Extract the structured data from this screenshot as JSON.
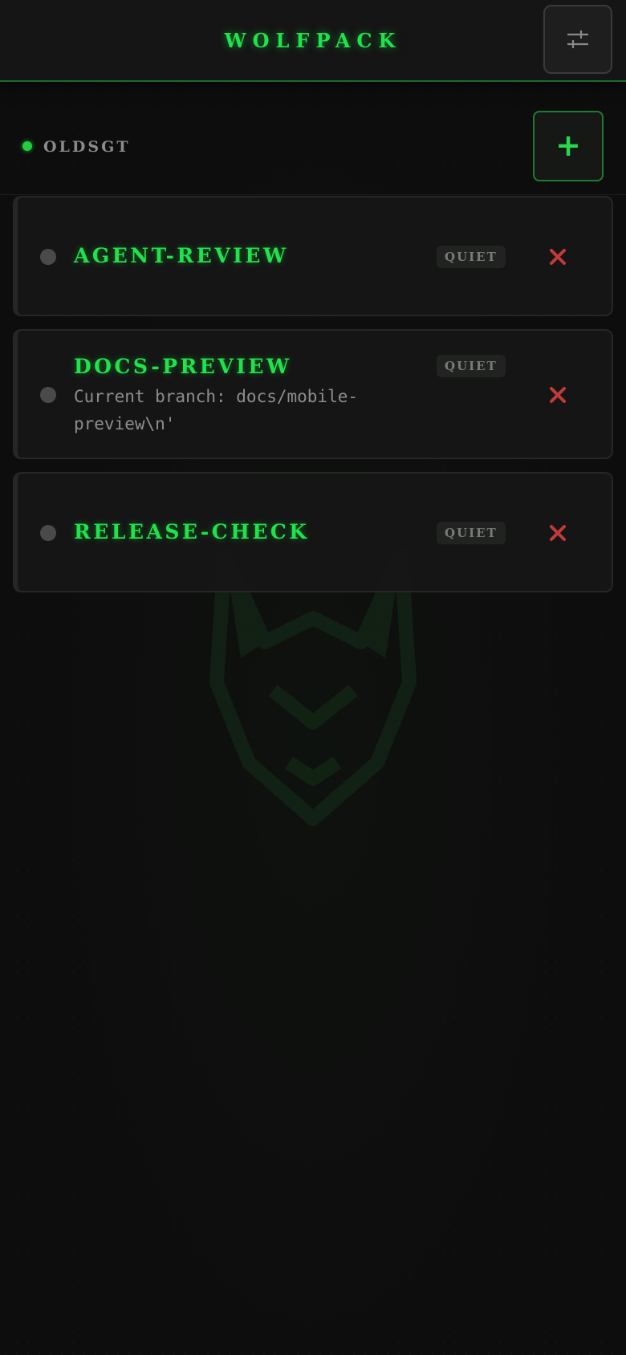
{
  "app": {
    "title": "WOLFPACK"
  },
  "header": {
    "settings_icon": "sliders-icon"
  },
  "account": {
    "name": "OLDSGT",
    "status_color": "#1fcf40",
    "add_icon_label": "+"
  },
  "sessions": [
    {
      "name": "AGENT-REVIEW",
      "status": "QUIET",
      "description": ""
    },
    {
      "name": "DOCS-PREVIEW",
      "status": "QUIET",
      "description": "Current branch: docs/mobile-preview\\n'"
    },
    {
      "name": "RELEASE-CHECK",
      "status": "QUIET",
      "description": ""
    }
  ],
  "colors": {
    "accent": "#1fe34a",
    "delete": "#c23a3a",
    "background": "#0d0d0d"
  }
}
